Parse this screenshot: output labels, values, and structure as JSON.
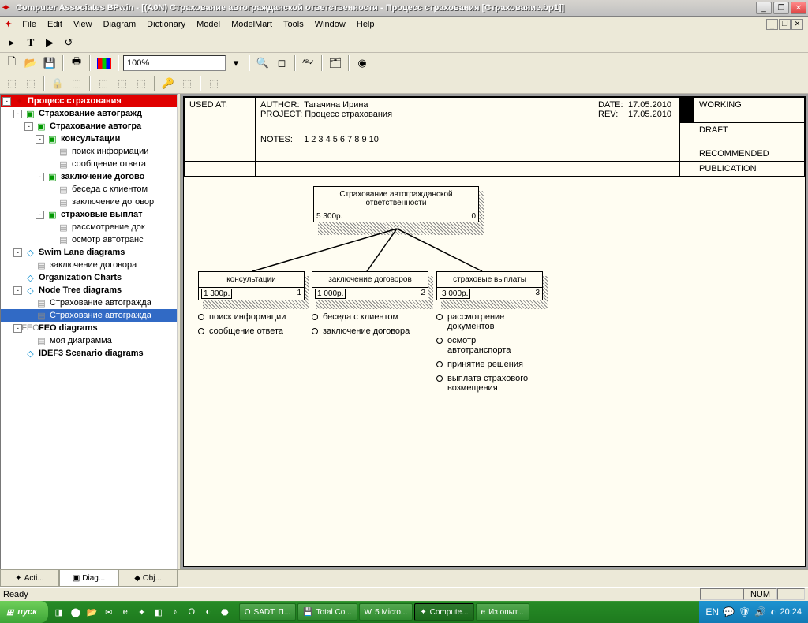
{
  "title": "Computer Associates BPwin - [(A0N) Страхование автогражданской  ответственности - Процесс страхования  [Страхование.bp1]]",
  "menu": [
    "File",
    "Edit",
    "View",
    "Diagram",
    "Dictionary",
    "Model",
    "ModelMart",
    "Tools",
    "Window",
    "Help"
  ],
  "zoom": "100%",
  "tree": [
    {
      "d": 0,
      "exp": "-",
      "ico": "✦",
      "lbl": "Процесс страхования",
      "cls": "selected bold"
    },
    {
      "d": 1,
      "exp": "-",
      "ico": "▣",
      "lbl": "Страхование автогражд",
      "cls": "bold"
    },
    {
      "d": 2,
      "exp": "-",
      "ico": "▣",
      "lbl": "Страхование автогра",
      "cls": "bold"
    },
    {
      "d": 3,
      "exp": "-",
      "ico": "▣",
      "lbl": "консультации",
      "cls": "bold"
    },
    {
      "d": 4,
      "exp": "",
      "ico": "▤",
      "lbl": "поиск информации"
    },
    {
      "d": 4,
      "exp": "",
      "ico": "▤",
      "lbl": "сообщение ответа"
    },
    {
      "d": 3,
      "exp": "-",
      "ico": "▣",
      "lbl": "заключение догово",
      "cls": "bold"
    },
    {
      "d": 4,
      "exp": "",
      "ico": "▤",
      "lbl": "беседа с клиентом"
    },
    {
      "d": 4,
      "exp": "",
      "ico": "▤",
      "lbl": "заключение договор"
    },
    {
      "d": 3,
      "exp": "-",
      "ico": "▣",
      "lbl": "страховые выплат",
      "cls": "bold"
    },
    {
      "d": 4,
      "exp": "",
      "ico": "▤",
      "lbl": "рассмотрение док"
    },
    {
      "d": 4,
      "exp": "",
      "ico": "▤",
      "lbl": "осмотр автотранс"
    },
    {
      "d": 1,
      "exp": "-",
      "ico": "◇",
      "lbl": "Swim Lane diagrams",
      "cls": "bold"
    },
    {
      "d": 2,
      "exp": "",
      "ico": "▤",
      "lbl": "заключение договора"
    },
    {
      "d": 1,
      "exp": "",
      "ico": "◇",
      "lbl": "Organization Charts",
      "cls": "bold"
    },
    {
      "d": 1,
      "exp": "-",
      "ico": "◇",
      "lbl": "Node Tree diagrams",
      "cls": "bold"
    },
    {
      "d": 2,
      "exp": "",
      "ico": "▤",
      "lbl": "Страхование автогражда"
    },
    {
      "d": 2,
      "exp": "",
      "ico": "▤",
      "lbl": "Страхование автогражда",
      "cls": "selected2"
    },
    {
      "d": 1,
      "exp": "-",
      "ico": "FEO",
      "lbl": "FEO diagrams",
      "cls": "bold"
    },
    {
      "d": 2,
      "exp": "",
      "ico": "▤",
      "lbl": "моя диаграмма"
    },
    {
      "d": 1,
      "exp": "",
      "ico": "◇",
      "lbl": "IDEF3 Scenario diagrams",
      "cls": "bold"
    }
  ],
  "sidebar_tabs": [
    {
      "ico": "✦",
      "lbl": "Acti..."
    },
    {
      "ico": "▣",
      "lbl": "Diag...",
      "active": true
    },
    {
      "ico": "◆",
      "lbl": "Obj..."
    }
  ],
  "header": {
    "used_at_lbl": "USED AT:",
    "author_lbl": "AUTHOR:",
    "author": "Тагачина Ирина",
    "project_lbl": "PROJECT:",
    "project": "Процесс страхования",
    "date_lbl": "DATE:",
    "date": "17.05.2010",
    "rev_lbl": "REV:",
    "rev": "17.05.2010",
    "notes_lbl": "NOTES:",
    "notes": "1  2  3  4  5  6  7  8  9  10",
    "status": [
      "WORKING",
      "DRAFT",
      "RECOMMENDED",
      "PUBLICATION"
    ]
  },
  "boxes": {
    "root": {
      "title": "Страхование автогражданской ответственности",
      "cost": "5 300р.",
      "num": "0"
    },
    "c1": {
      "title": "консультации",
      "cost": "1 300р.",
      "num": "1"
    },
    "c2": {
      "title": "заключение договоров",
      "cost": "1 000р.",
      "num": "2"
    },
    "c3": {
      "title": "страховые выплаты",
      "cost": "3 000р.",
      "num": "3"
    }
  },
  "bullets": {
    "b1": [
      "поиск информации",
      "сообщение ответа"
    ],
    "b2": [
      "беседа с клиентом",
      "заключение договора"
    ],
    "b3": [
      "рассмотрение документов",
      "осмотр автотранспорта",
      "принятие решения",
      "выплата страхового возмещения"
    ]
  },
  "status": {
    "ready": "Ready",
    "num": "NUM"
  },
  "taskbar": {
    "start": "пуск",
    "tasks": [
      {
        "ico": "O",
        "lbl": "SADT: П..."
      },
      {
        "ico": "💾",
        "lbl": "Total Co..."
      },
      {
        "ico": "W",
        "lbl": "5 Micro..."
      },
      {
        "ico": "✦",
        "lbl": "Compute...",
        "active": true
      },
      {
        "ico": "e",
        "lbl": "Из опыт..."
      }
    ],
    "lang": "EN",
    "clock": "20:24"
  }
}
